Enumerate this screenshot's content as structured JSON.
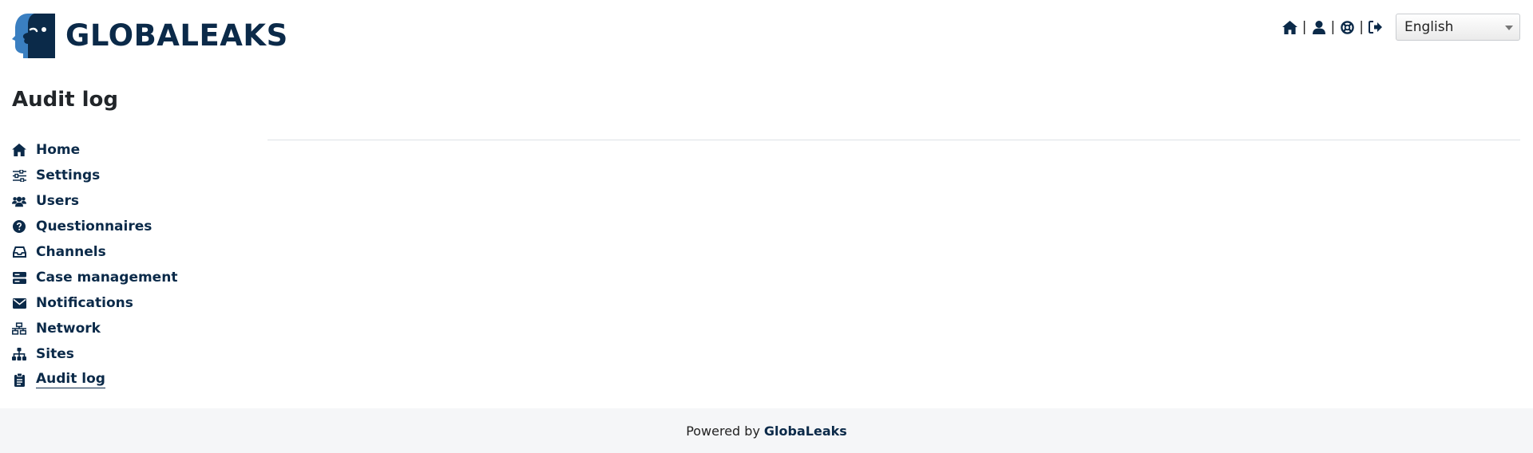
{
  "app": {
    "logo_text": "GLOBALEAKS",
    "accent": "#0b2a49"
  },
  "topnav": {
    "icons": [
      "home-icon",
      "user-icon",
      "support-icon",
      "logout-icon"
    ],
    "separator": "|",
    "language": "English"
  },
  "page": {
    "title": "Audit log"
  },
  "sidebar": {
    "items": [
      {
        "label": "Home",
        "icon": "home-icon"
      },
      {
        "label": "Settings",
        "icon": "sliders-icon"
      },
      {
        "label": "Users",
        "icon": "users-icon"
      },
      {
        "label": "Questionnaires",
        "icon": "question-circle-icon"
      },
      {
        "label": "Channels",
        "icon": "inbox-icon"
      },
      {
        "label": "Case management",
        "icon": "server-icon"
      },
      {
        "label": "Notifications",
        "icon": "envelope-icon"
      },
      {
        "label": "Network",
        "icon": "network-icon"
      },
      {
        "label": "Sites",
        "icon": "sitemap-icon"
      },
      {
        "label": "Audit log",
        "icon": "clipboard-icon",
        "active": true
      }
    ]
  },
  "footer": {
    "prefix": "Powered by",
    "brand": "GlobaLeaks"
  }
}
